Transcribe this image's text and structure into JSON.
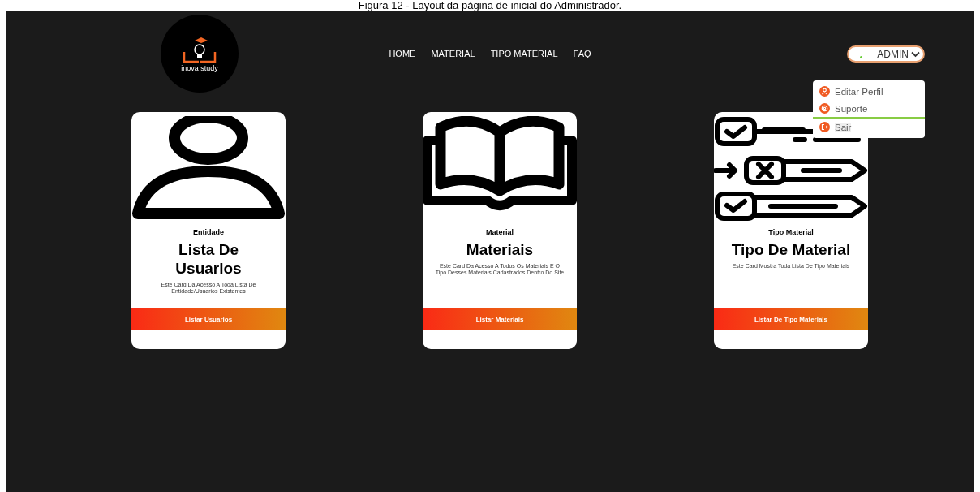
{
  "caption": "Figura 12 - Layout da página de inicial do Administrador.",
  "logo": {
    "text": "inova study"
  },
  "nav": [
    "HOME",
    "MATERIAL",
    "TIPO MATERIAL",
    "FAQ"
  ],
  "user_menu": {
    "label": "ADMIN",
    "expanded": true,
    "items": [
      {
        "label": "Editar Perfil",
        "kind": "profile",
        "selected": false
      },
      {
        "label": "Suporte",
        "kind": "support",
        "selected": false
      },
      {
        "label": "Sair",
        "kind": "logout",
        "selected": true
      }
    ]
  },
  "cards": [
    {
      "kind": "user",
      "category": "Entidade",
      "title": "Lista De Usuarios",
      "description": "Este Card Da Acesso A Toda Lista De Entidade/Usuarios Existentes",
      "button": "Listar Usuarios"
    },
    {
      "kind": "book",
      "category": "Material",
      "title": "Materiais",
      "description": "Este Card Da Acesso A Todos Os Materiais E O Tipo Desses Materiais Cadastrados Dentro Do Site",
      "button": "Listar Materiais"
    },
    {
      "kind": "checklist",
      "category": "Tipo Material",
      "title": "Tipo De Material",
      "description": "Este Card Mostra Toda Lista De Tipo Materiais",
      "button": "Listar De Tipo Materiais"
    }
  ]
}
